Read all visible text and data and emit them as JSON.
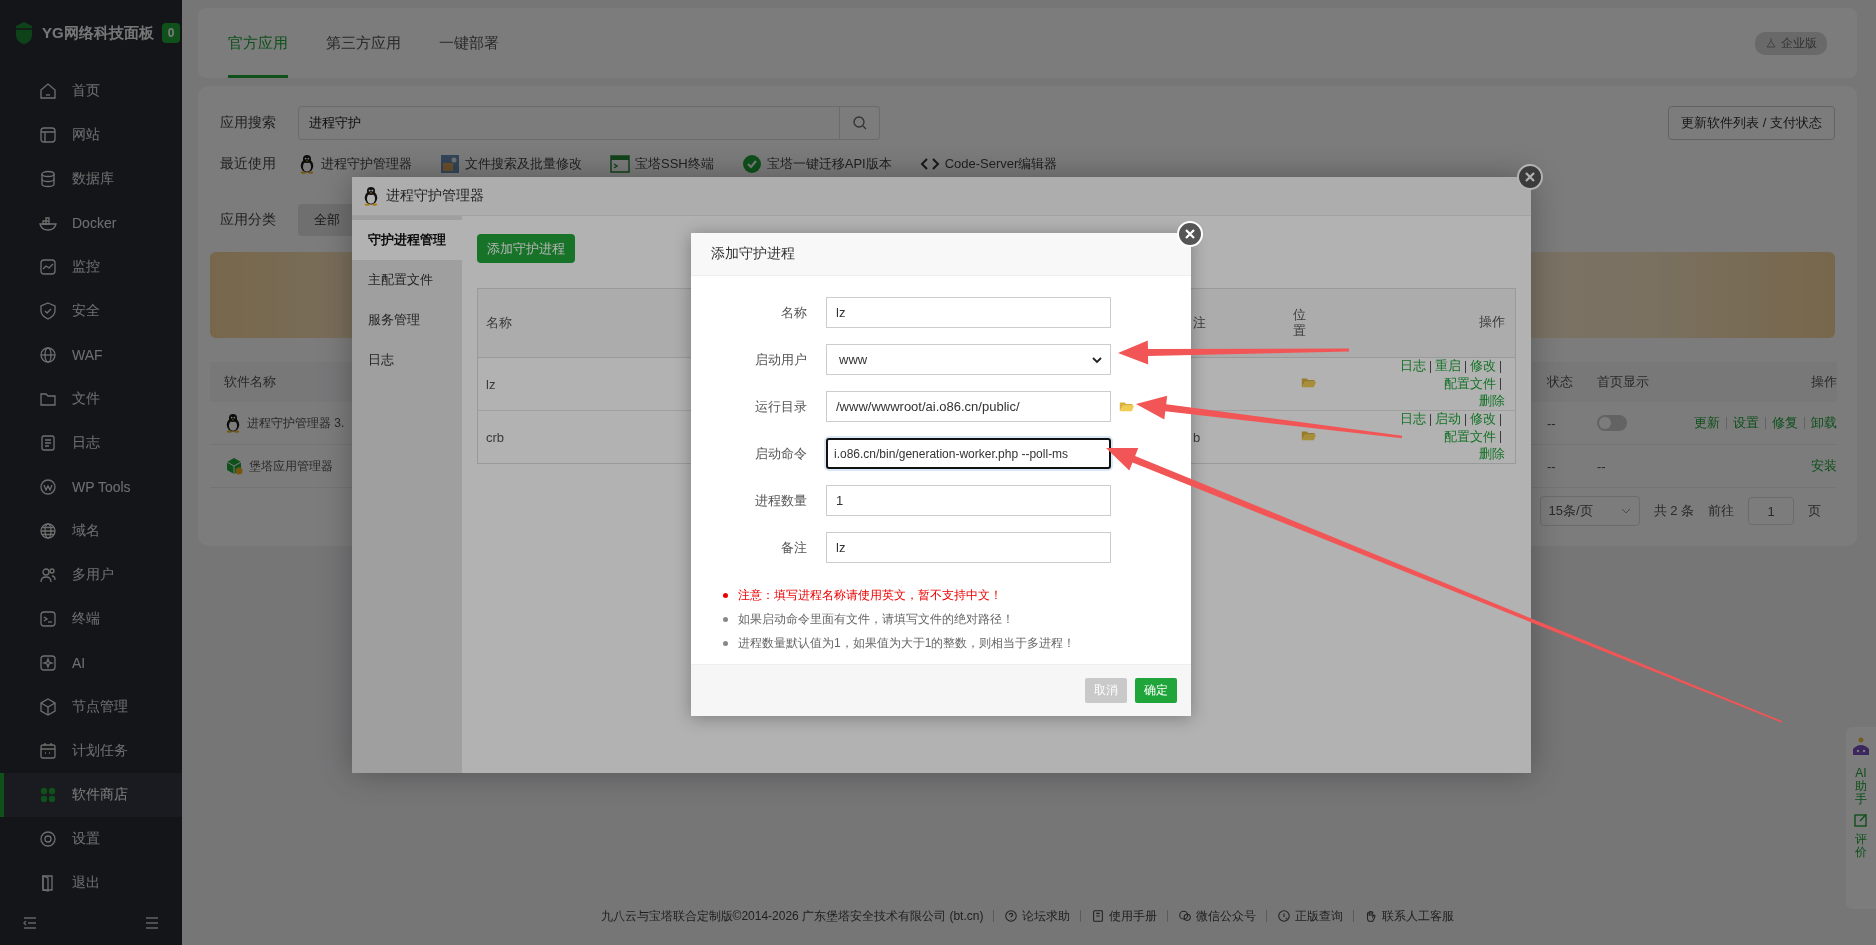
{
  "sidebar": {
    "logo": "YG网络科技面板",
    "badge": "0",
    "items": [
      {
        "label": "首页",
        "selected": false
      },
      {
        "label": "网站",
        "selected": false
      },
      {
        "label": "数据库",
        "selected": false
      },
      {
        "label": "Docker",
        "selected": false
      },
      {
        "label": "监控",
        "selected": false
      },
      {
        "label": "安全",
        "selected": false
      },
      {
        "label": "WAF",
        "selected": false
      },
      {
        "label": "文件",
        "selected": false
      },
      {
        "label": "日志",
        "selected": false
      },
      {
        "label": "WP Tools",
        "selected": false
      },
      {
        "label": "域名",
        "selected": false
      },
      {
        "label": "多用户",
        "selected": false
      },
      {
        "label": "终端",
        "selected": false
      },
      {
        "label": "AI",
        "selected": false
      },
      {
        "label": "节点管理",
        "selected": false
      },
      {
        "label": "计划任务",
        "selected": false
      },
      {
        "label": "软件商店",
        "selected": true
      },
      {
        "label": "设置",
        "selected": false
      },
      {
        "label": "退出",
        "selected": false
      }
    ]
  },
  "top_tabs": [
    {
      "label": "官方应用",
      "selected": true
    },
    {
      "label": "第三方应用",
      "selected": false
    },
    {
      "label": "一键部署",
      "selected": false
    }
  ],
  "edition_badge": "企业版",
  "search": {
    "label": "应用搜索",
    "value": "进程守护"
  },
  "refresh_button": "更新软件列表 / 支付状态",
  "recent": {
    "label": "最近使用",
    "items": [
      {
        "name": "进程守护管理器"
      },
      {
        "name": "文件搜索及批量修改"
      },
      {
        "name": "宝塔SSH终端"
      },
      {
        "name": "宝塔一键迁移API版本"
      },
      {
        "name": "Code-Server编辑器"
      }
    ]
  },
  "categories": {
    "label": "应用分类",
    "items": [
      {
        "label": "全部",
        "selected": true
      }
    ]
  },
  "software_table": {
    "columns": [
      "软件名称",
      "状态",
      "首页显示",
      "操作"
    ],
    "rows": [
      {
        "name": "进程守护管理器 3.",
        "status": "--",
        "home_display": {
          "kind": "toggle",
          "on": false
        },
        "actions": [
          "更新",
          "设置",
          "修复",
          "卸载"
        ]
      },
      {
        "name": "堡塔应用管理器",
        "status": "--",
        "home_display": {
          "kind": "text",
          "text": "--"
        },
        "actions": [
          "安装"
        ]
      }
    ]
  },
  "pagination": {
    "page_size": "15条/页",
    "total": "共 2 条",
    "goto_label": "前往",
    "page": "1",
    "page_suffix": "页"
  },
  "footer": {
    "copyright": "九八云与宝塔联合定制版©2014-2026 广东堡塔安全技术有限公司 (bt.cn)",
    "links": [
      {
        "label": "论坛求助"
      },
      {
        "label": "使用手册"
      },
      {
        "label": "微信公众号"
      },
      {
        "label": "正版查询"
      },
      {
        "label": "联系人工客服"
      }
    ]
  },
  "float_widget": {
    "ai": "AI助手",
    "review": "评价"
  },
  "manager_modal": {
    "title": "进程守护管理器",
    "nav": [
      {
        "label": "守护进程管理",
        "selected": true
      },
      {
        "label": "主配置文件",
        "selected": false
      },
      {
        "label": "服务管理",
        "selected": false
      },
      {
        "label": "日志",
        "selected": false
      }
    ],
    "add_button": "添加守护进程",
    "columns": {
      "name": "名称",
      "column_3": "注",
      "location": "位置",
      "actions": "操作"
    },
    "rows": [
      {
        "name": "lz",
        "actions": [
          "日志",
          "重启",
          "修改",
          "配置文件",
          "删除"
        ]
      },
      {
        "name": "crb",
        "column_3": "b",
        "actions": [
          "日志",
          "启动",
          "修改",
          "配置文件",
          "删除"
        ]
      }
    ]
  },
  "dialog": {
    "title": "添加守护进程",
    "fields": [
      {
        "label": "名称",
        "kind": "text",
        "value": "lz",
        "focused": false
      },
      {
        "label": "启动用户",
        "kind": "select",
        "value": "www",
        "focused": false
      },
      {
        "label": "运行目录",
        "kind": "path",
        "value": "/www/wwwroot/ai.o86.cn/public/",
        "focused": false
      },
      {
        "label": "启动命令",
        "kind": "text",
        "value": "i.o86.cn/bin/generation-worker.php --poll-ms",
        "focused": true
      },
      {
        "label": "进程数量",
        "kind": "text",
        "value": "1",
        "focused": false
      },
      {
        "label": "备注",
        "kind": "text",
        "value": "lz",
        "focused": false
      }
    ],
    "notes": [
      {
        "text": "注意：填写进程名称请使用英文，暂不支持中文！",
        "kind": "warning"
      },
      {
        "text": "如果启动命令里面有文件，请填写文件的绝对路径！",
        "kind": "info"
      },
      {
        "text": "进程数量默认值为1，如果值为大于1的整数，则相当于多进程！",
        "kind": "info"
      }
    ],
    "buttons": [
      {
        "label": "取消",
        "kind": "cancel"
      },
      {
        "label": "确定",
        "kind": "primary"
      }
    ]
  }
}
